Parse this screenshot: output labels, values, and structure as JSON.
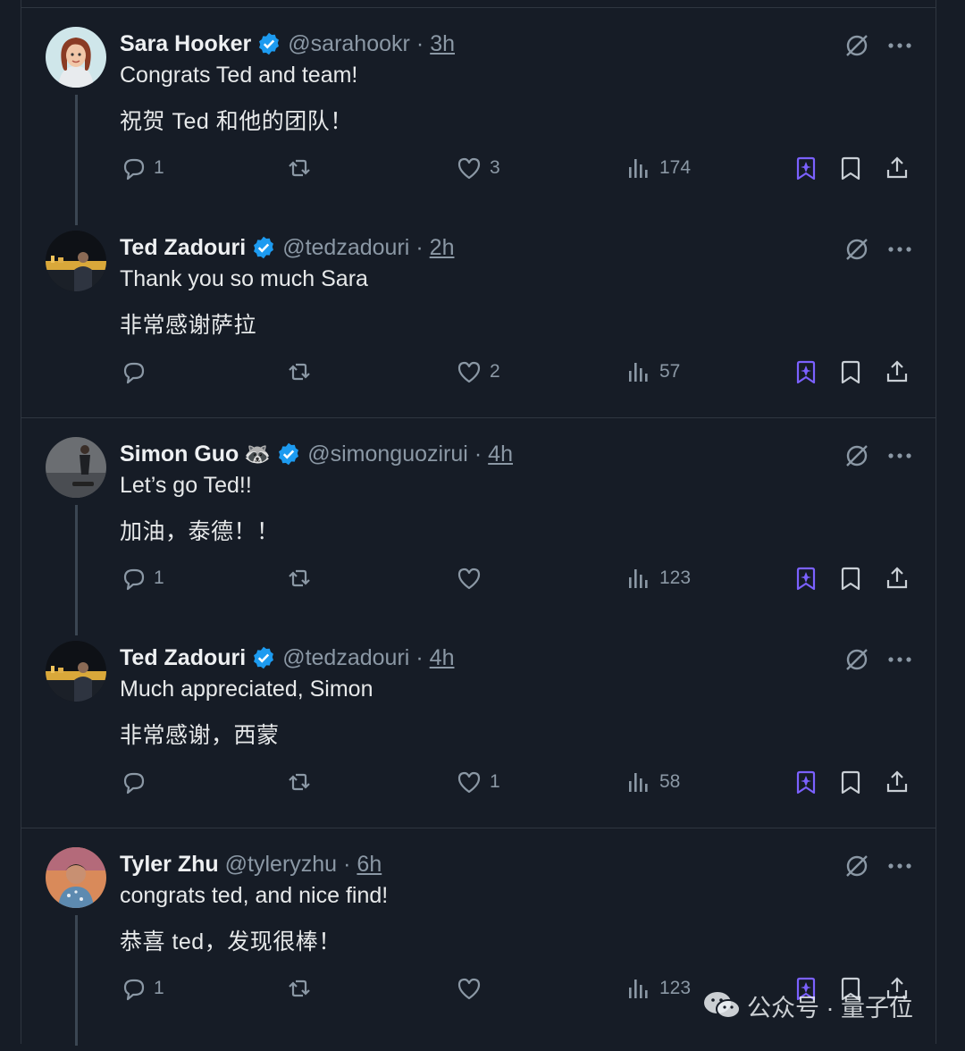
{
  "tweets": [
    {
      "name": "Sara Hooker",
      "emoji": "",
      "handle": "@sarahookr",
      "sep": "·",
      "time": "3h",
      "text_en": "Congrats Ted and team!",
      "text_zh": "祝贺 Ted 和他的团队！",
      "replies": "1",
      "retweets": "",
      "likes": "3",
      "views": "174",
      "thread": true
    },
    {
      "name": "Ted Zadouri",
      "emoji": "",
      "handle": "@tedzadouri",
      "sep": "·",
      "time": "2h",
      "text_en": "Thank you so much Sara",
      "text_zh": "非常感谢萨拉",
      "replies": "",
      "retweets": "",
      "likes": "2",
      "views": "57",
      "thread": false
    },
    {
      "name": "Simon Guo",
      "emoji": "🦝",
      "handle": "@simonguozirui",
      "sep": "·",
      "time": "4h",
      "text_en": "Let’s go Ted!!",
      "text_zh": "加油，泰德！！",
      "replies": "1",
      "retweets": "",
      "likes": "",
      "views": "123",
      "thread": true
    },
    {
      "name": "Ted Zadouri",
      "emoji": "",
      "handle": "@tedzadouri",
      "sep": "·",
      "time": "4h",
      "text_en": "Much appreciated, Simon",
      "text_zh": "非常感谢，西蒙",
      "replies": "",
      "retweets": "",
      "likes": "1",
      "views": "58",
      "thread": false
    },
    {
      "name": "Tyler Zhu",
      "emoji": "",
      "handle": "@tyleryzhu",
      "sep": "·",
      "time": "6h",
      "text_en": "congrats ted, and nice find!",
      "text_zh": "恭喜 ted，发现很棒！",
      "replies": "1",
      "retweets": "",
      "likes": "",
      "views": "123",
      "thread": true
    }
  ],
  "icons": {
    "reply": "reply-icon",
    "retweet": "retweet-icon",
    "like": "heart-icon",
    "views": "views-chart-icon",
    "grok": "grok-icon",
    "bookmark": "bookmark-icon",
    "share": "share-icon",
    "more": "more-dots-icon",
    "verified": "verified-badge-icon"
  },
  "colors": {
    "background": "#161c26",
    "accent_grok": "#7b61ff",
    "verified": "#1d9bf0",
    "muted": "#8b98a5"
  },
  "watermark": {
    "text": "公众号 · 量子位"
  }
}
